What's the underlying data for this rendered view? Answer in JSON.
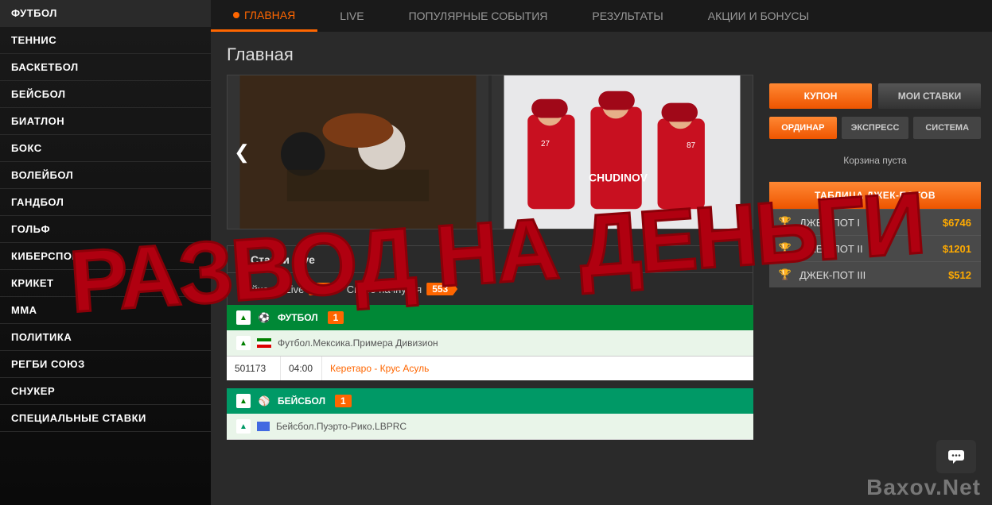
{
  "sidebar": {
    "items": [
      {
        "label": "ФУТБОЛ"
      },
      {
        "label": "ТЕННИС"
      },
      {
        "label": "БАСКЕТБОЛ"
      },
      {
        "label": "БЕЙСБОЛ"
      },
      {
        "label": "БИАТЛОН"
      },
      {
        "label": "БОКС"
      },
      {
        "label": "ВОЛЕЙБОЛ"
      },
      {
        "label": "ГАНДБОЛ"
      },
      {
        "label": "ГОЛЬФ"
      },
      {
        "label": "КИБЕРСПОРТ"
      },
      {
        "label": "КРИКЕТ"
      },
      {
        "label": "ММА"
      },
      {
        "label": "ПОЛИТИКА"
      },
      {
        "label": "РЕГБИ СОЮЗ"
      },
      {
        "label": "СНУКЕР"
      },
      {
        "label": "СПЕЦИАЛЬНЫЕ СТАВКИ"
      }
    ]
  },
  "topnav": {
    "items": [
      {
        "label": "ГЛАВНАЯ",
        "active": true
      },
      {
        "label": "LIVE"
      },
      {
        "label": "ПОПУЛЯРНЫЕ СОБЫТИЯ"
      },
      {
        "label": "РЕЗУЛЬТАТЫ"
      },
      {
        "label": "АКЦИИ И БОНУСЫ"
      }
    ]
  },
  "page_title": "Главная",
  "live_section": {
    "header": "Ставки Live",
    "tab_now": "Сейчас в Live",
    "tab_now_count": "19",
    "tab_soon": "Скоро начнутся",
    "tab_soon_count": "553"
  },
  "sports": [
    {
      "name": "ФУТБОЛ",
      "count": "1",
      "league": "Футбол.Мексика.Примера Дивизион",
      "match": {
        "id": "501173",
        "time": "04:00",
        "teams": "Керетаро - Крус Асуль"
      }
    },
    {
      "name": "БЕЙСБОЛ",
      "count": "1",
      "league": "Бейсбол.Пуэрто-Рико.LBPRC"
    }
  ],
  "right_panel": {
    "tab_coupon": "КУПОН",
    "tab_mybets": "МОИ СТАВКИ",
    "bet_single": "ОРДИНАР",
    "bet_express": "ЭКСПРЕСС",
    "bet_system": "СИСТЕМА",
    "basket_empty": "Корзина пуста",
    "jackpot_title": "ТАБЛИЦА ДЖЕК-ПОТОВ",
    "jackpots": [
      {
        "name": "ДЖЕК-ПОТ I",
        "amount": "$6746"
      },
      {
        "name": "ДЖЕК-ПОТ II",
        "amount": "$1201"
      },
      {
        "name": "ДЖЕК-ПОТ III",
        "amount": "$512"
      }
    ]
  },
  "overlay_text": "РАЗВОД НА ДЕНЬГИ",
  "watermark": "Baxov.Net"
}
